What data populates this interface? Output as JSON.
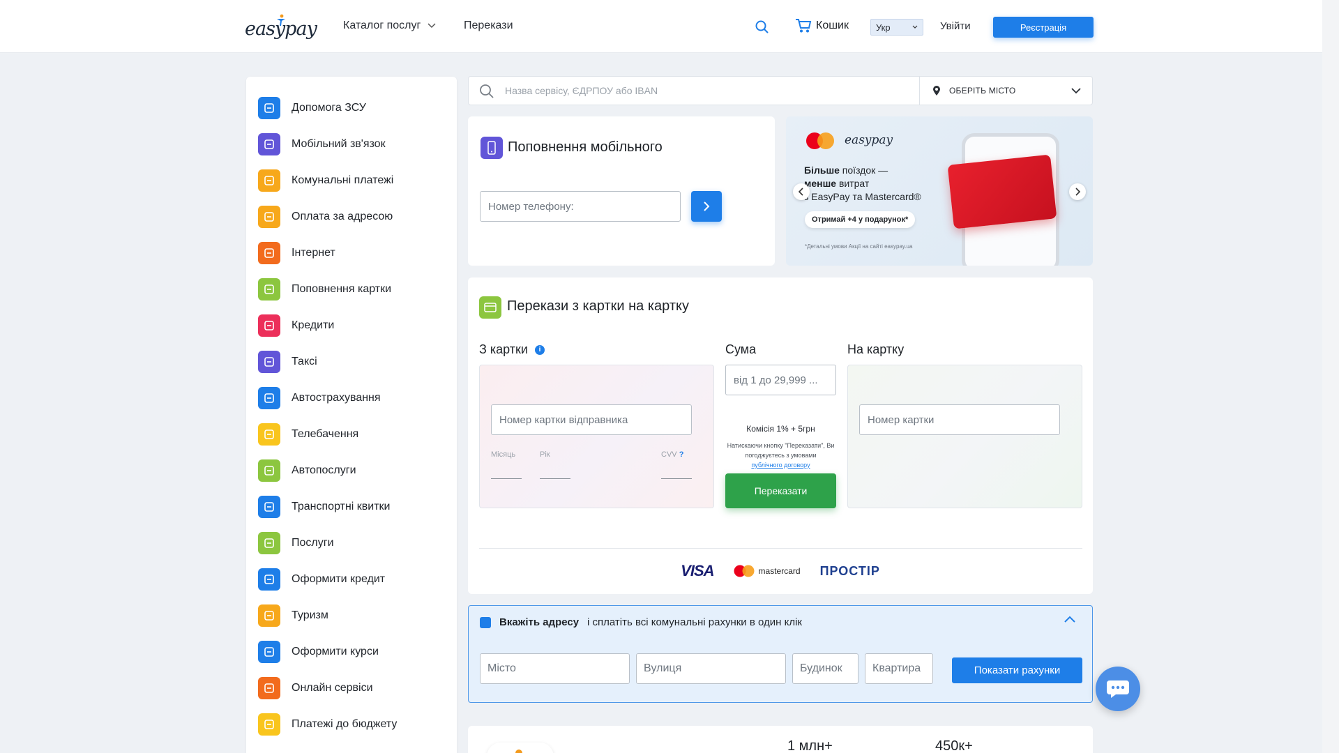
{
  "header": {
    "logo_text": "easypay",
    "catalog_label": "Каталог послуг",
    "transfers_label": "Перекази",
    "cart_label": "Кошик",
    "language": "Укр",
    "logout_label": "Увійти",
    "register_label": "Реєстрація"
  },
  "sidebar": {
    "items": [
      {
        "label": "Допомога ЗСУ",
        "color": "#1e7ee8",
        "icon": "military-help-icon"
      },
      {
        "label": "Мобільний зв'язок",
        "color": "#6155d8",
        "icon": "phone-icon"
      },
      {
        "label": "Комунальні платежі",
        "color": "#f7a81b",
        "icon": "bulb-icon"
      },
      {
        "label": "Оплата за адресою",
        "color": "#f7a81b",
        "icon": "house-icon"
      },
      {
        "label": "Інтернет",
        "color": "#f26b1d",
        "icon": "globe-icon"
      },
      {
        "label": "Поповнення картки",
        "color": "#8cc63f",
        "icon": "card-icon"
      },
      {
        "label": "Кредити",
        "color": "#ec2f5a",
        "icon": "bank-icon"
      },
      {
        "label": "Таксі",
        "color": "#6155d8",
        "icon": "taxi-icon"
      },
      {
        "label": "Автострахування",
        "color": "#1e7ee8",
        "icon": "car-insurance-icon"
      },
      {
        "label": "Телебачення",
        "color": "#f9c51d",
        "icon": "tv-icon"
      },
      {
        "label": "Автопослуги",
        "color": "#8cc63f",
        "icon": "car-icon"
      },
      {
        "label": "Транспортні квитки",
        "color": "#1e7ee8",
        "icon": "bus-icon"
      },
      {
        "label": "Послуги",
        "color": "#8cc63f",
        "icon": "puzzle-icon"
      },
      {
        "label": "Оформити кредит",
        "color": "#1e7ee8",
        "icon": "credit-card-icon"
      },
      {
        "label": "Туризм",
        "color": "#f7a81b",
        "icon": "plane-icon"
      },
      {
        "label": "Оформити курси",
        "color": "#1e7ee8",
        "icon": "laptop-icon"
      },
      {
        "label": "Онлайн сервіси",
        "color": "#f26b1d",
        "icon": "monitor-icon"
      },
      {
        "label": "Платежі до бюджету",
        "color": "#f9c51d",
        "icon": "budget-icon"
      }
    ]
  },
  "search": {
    "placeholder": "Назва сервісу, ЄДРПОУ або IBAN",
    "city_label": "ОБЕРІТЬ МІСТО"
  },
  "mobile": {
    "title": "Поповнення мобільного",
    "phone_placeholder": "Номер телефону:"
  },
  "banner": {
    "logo": "easypay",
    "headline_bold1": "Більше",
    "headline_1": " поїздок —",
    "headline_bold2": "менше",
    "headline_2": " витрат",
    "headline_3": "з EasyPay та Mastercard®",
    "gift": "Отримай +4 у подарунок*",
    "terms": "*Детальні умови Акції на сайті easypay.ua"
  },
  "transfer": {
    "title": "Перекази з картки на картку",
    "from_label": "З картки",
    "sum_label": "Сума",
    "to_label": "На картку",
    "from_placeholder": "Номер картки відправника",
    "month_label": "Місяць",
    "year_label": "Рік",
    "cvv_label": "CVV",
    "cvv_hint": "?",
    "sum_placeholder": "від 1 до 29,999 ...",
    "commission": "Комісія 1% + 5грн",
    "agree_text": "Натискаючи кнопку \"Переказати\", Ви погоджуєтесь з умовами",
    "agree_link": "публічного договору",
    "send_label": "Переказати",
    "to_placeholder": "Номер картки",
    "logos": {
      "visa": "VISA",
      "mastercard": "mastercard",
      "prostir": "ПРОСТІР"
    }
  },
  "address": {
    "bold": "Вкажіть адресу",
    "rest": "і сплатіть всі комунальні рахунки в один клік",
    "city_placeholder": "Місто",
    "street_placeholder": "Вулиця",
    "house_placeholder": "Будинок",
    "apt_placeholder": "Квартира",
    "button": "Показати рахунки"
  },
  "stats": {
    "stat1": "1 млн+",
    "stat2": "450к+"
  },
  "colors": {
    "accent": "#1e7ee8",
    "success": "#2ea24a"
  }
}
